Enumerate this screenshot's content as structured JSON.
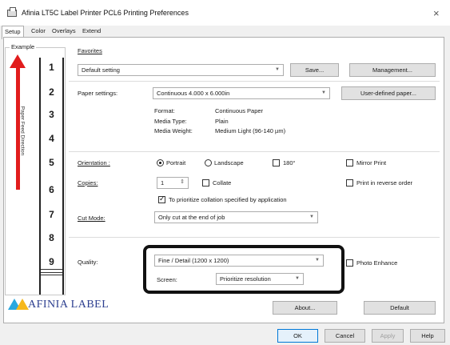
{
  "window": {
    "title": "Afinia LT5C Label Printer PCL6 Printing Preferences",
    "close_glyph": "×"
  },
  "tabs": [
    "Setup",
    "Color",
    "Overlays",
    "Extend"
  ],
  "example": {
    "label": "Example",
    "feed_direction": "Paper Feed Direction",
    "numbers": [
      "1",
      "2",
      "3",
      "4",
      "5",
      "6",
      "7",
      "8",
      "9"
    ]
  },
  "favorites": {
    "label": "Favorites",
    "value": "Default setting",
    "save_button": "Save...",
    "management_button": "Management..."
  },
  "paper": {
    "label": "Paper settings:",
    "value": "Continuous 4.000 x 6.000in",
    "user_defined_button": "User-defined paper...",
    "format_label": "Format:",
    "format_value": "Continuous Paper",
    "media_type_label": "Media Type:",
    "media_type_value": "Plain",
    "media_weight_label": "Media Weight:",
    "media_weight_value": "Medium Light (96-140 µm)"
  },
  "orientation": {
    "label": "Orientation :",
    "portrait": "Portrait",
    "landscape": "Landscape",
    "rotate180": "180°",
    "mirror": "Mirror Print",
    "portrait_checked": true
  },
  "copies": {
    "label": "Copies:",
    "value": "1",
    "collate": "Collate",
    "reverse": "Print in reverse order",
    "prioritize": "To prioritize collation specified by application",
    "prioritize_checked": true
  },
  "cut_mode": {
    "label": "Cut Mode:",
    "value": "Only cut at the end of job"
  },
  "quality": {
    "label": "Quality:",
    "value": "Fine / Detail (1200 x 1200)",
    "screen_label": "Screen:",
    "screen_value": "Prioritize resolution",
    "photo_enhance": "Photo Enhance"
  },
  "logo": {
    "text": "AFINIA LABEL"
  },
  "footer": {
    "about_button": "About...",
    "default_button": "Default",
    "ok_button": "OK",
    "cancel_button": "Cancel",
    "apply_button": "Apply",
    "help_button": "Help"
  },
  "colors": {
    "highlight": "#111111",
    "arrow": "#e11c1c",
    "logo_blue": "#29a8e0",
    "logo_yellow": "#f6b81c"
  }
}
